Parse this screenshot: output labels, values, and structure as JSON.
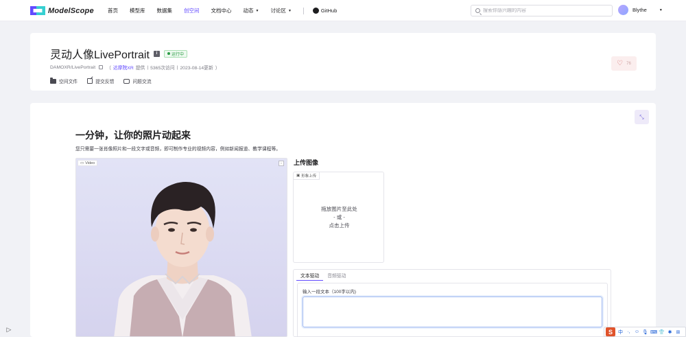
{
  "nav": {
    "logo_text": "ModelScope",
    "items": [
      {
        "label": "首页"
      },
      {
        "label": "模型库"
      },
      {
        "label": "数据集"
      },
      {
        "label": "创空间"
      },
      {
        "label": "文档中心"
      },
      {
        "label": "动态"
      },
      {
        "label": "讨论区"
      },
      {
        "label": "GitHub"
      }
    ],
    "search_placeholder": "搜索你感兴趣的内容",
    "user_name": "Blythe"
  },
  "header": {
    "title": "灵动人像LivePortrait",
    "info_glyph": "i",
    "status": "运行中",
    "repo": "DAMOXR/LivePortrait",
    "provider_open": "（",
    "provider": "达摩院XR",
    "provider_suffix": "提供",
    "sep": "|",
    "visits": "5365次访问",
    "updated": "2023-08-14更新",
    "provider_close": "）",
    "actions": [
      {
        "label": "空间文件"
      },
      {
        "label": "提交反馈"
      },
      {
        "label": "问题交流"
      }
    ],
    "likes": "76"
  },
  "main": {
    "collapse_glyph": "⤡",
    "title": "一分钟，让你的照片动起来",
    "description": "您只需要一张肖像照片和一段文字或音频，即可制作专业的视频内容，例如新闻报道、教学课程等。",
    "video_label": "Video",
    "video_label_glyph": "▭",
    "download_glyph": "↓",
    "upload_heading": "上传图像",
    "upload_tag": "形象上传",
    "upload_tag_glyph": "▣",
    "upload_line1": "拖放图片至此处",
    "upload_line2": "- 或 -",
    "upload_line3": "点击上传",
    "tabs": [
      {
        "label": "文本驱动"
      },
      {
        "label": "音频驱动"
      }
    ],
    "text_label": "输入一段文本（100字以内)"
  },
  "sidebar_toggle_glyph": "▷",
  "ime": {
    "logo": "S",
    "items": [
      "中",
      "·,",
      "☺",
      "🎙",
      "⌨",
      "👕",
      "✱",
      "⊞"
    ]
  }
}
